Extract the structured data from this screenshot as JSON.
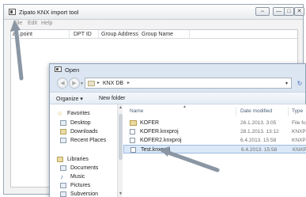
{
  "app": {
    "title": "Zipato KNX import tool",
    "window_controls": {
      "restore": "⇔",
      "minimize": "—",
      "maximize": "□",
      "close": "✕"
    },
    "menu": [
      "File",
      "Edit",
      "Help"
    ],
    "table": {
      "columns": [
        "a...point",
        "DPT ID",
        "Group Address",
        "Group Name"
      ]
    }
  },
  "dialog": {
    "title": "Open",
    "address": {
      "path": "KNX DB",
      "separator": "▸",
      "dropdown": "▾",
      "refresh": "↻"
    },
    "toolbar": {
      "organize": "Organize ▾",
      "new_folder": "New folder"
    },
    "navigation": {
      "groups": [
        {
          "label": "Favorites",
          "icon": "star-icon",
          "items": [
            {
              "label": "Desktop",
              "icon": "desktop-icon"
            },
            {
              "label": "Downloads",
              "icon": "downloads-icon"
            },
            {
              "label": "Recent Places",
              "icon": "recent-places-icon"
            }
          ]
        },
        {
          "label": "Libraries",
          "icon": "libraries-icon",
          "items": [
            {
              "label": "Documents",
              "icon": "documents-icon"
            },
            {
              "label": "Music",
              "icon": "music-icon"
            },
            {
              "label": "Pictures",
              "icon": "pictures-icon"
            },
            {
              "label": "Subversion",
              "icon": "subversion-icon"
            }
          ]
        }
      ]
    },
    "files": {
      "columns": {
        "name": "Name",
        "date": "Date modified",
        "type": "Type"
      },
      "rows": [
        {
          "name": "KOFER",
          "date": "26.1.2013. 3:05",
          "type": "File fo",
          "icon": "folder-icon",
          "selected": false
        },
        {
          "name": "KOFER.knxproj",
          "date": "28.1.2013. 13:12",
          "type": "KNXP",
          "icon": "file-icon",
          "selected": false
        },
        {
          "name": "KOFER2.knxproj",
          "date": "6.4.2013. 15:58",
          "type": "KNXP",
          "icon": "file-icon",
          "selected": false
        },
        {
          "name": "Test.knxproj",
          "date": "6.4.2013. 15:58",
          "type": "KNXP",
          "icon": "file-icon",
          "selected": true
        }
      ]
    }
  },
  "colors": {
    "dialog_frame": "#dce6f2",
    "selection": "#dbe8f7",
    "arrow": "#8a96a3"
  }
}
